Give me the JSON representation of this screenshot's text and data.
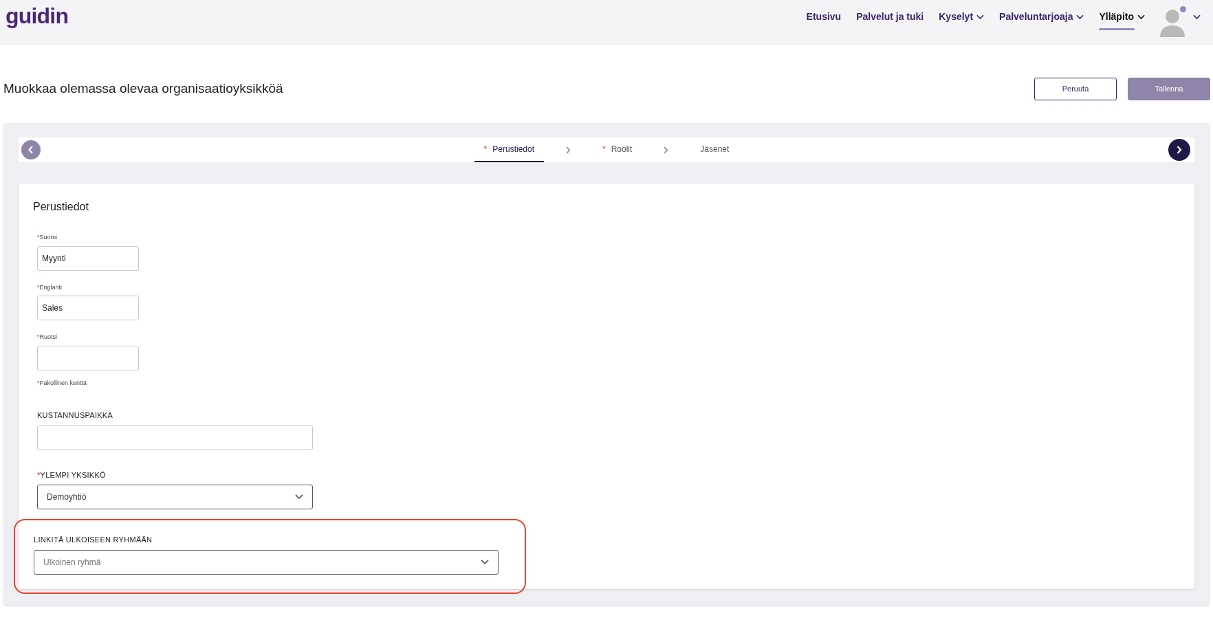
{
  "header": {
    "logo": "guidin",
    "nav": [
      {
        "label": "Etusivu",
        "dropdown": false,
        "selected": false
      },
      {
        "label": "Palvelut ja tuki",
        "dropdown": false,
        "selected": false
      },
      {
        "label": "Kyselyt",
        "dropdown": true,
        "selected": false
      },
      {
        "label": "Palveluntarjoaja",
        "dropdown": true,
        "selected": false
      },
      {
        "label": "Ylläpito",
        "dropdown": true,
        "selected": true
      }
    ],
    "user": {
      "notification": true
    }
  },
  "page": {
    "title": "Muokkaa olemassa olevaa organisaatioyksikköä",
    "buttons": [
      {
        "label": "Peruuta",
        "kind": "secondary"
      },
      {
        "label": "Tallenna",
        "kind": "primary"
      }
    ]
  },
  "stepper": {
    "steps": [
      {
        "mark": "*",
        "label": "Perustiedot",
        "selected": true
      },
      {
        "mark": "*",
        "label": "Roolit",
        "selected": false
      },
      {
        "label": "Jäsenet",
        "selected": false
      }
    ]
  },
  "card": {
    "title": "Perustiedot",
    "fields": [
      {
        "kind": "small",
        "mark": "*",
        "label": "Suomi",
        "value": "Myynti"
      },
      {
        "kind": "small",
        "mark": "*",
        "label": "Englanti",
        "value": "Sales"
      },
      {
        "kind": "small",
        "mark": "*",
        "label": "Ruotsi"
      },
      {
        "kind": "note",
        "mark": "*",
        "label": "Pakollinen kenttä"
      },
      {
        "kind": "text",
        "label": "KUSTANNUSPAIKKA"
      },
      {
        "kind": "select",
        "mark": "*",
        "label": "YLEMPI YKSIKKÖ",
        "value": "Demoyhtiö"
      },
      {
        "kind": "select",
        "label": "LINKITÄ ULKOISEEN RYHMÄÄN",
        "placeholder": "Ulkoinen ryhmä",
        "highlighted": true
      }
    ]
  }
}
